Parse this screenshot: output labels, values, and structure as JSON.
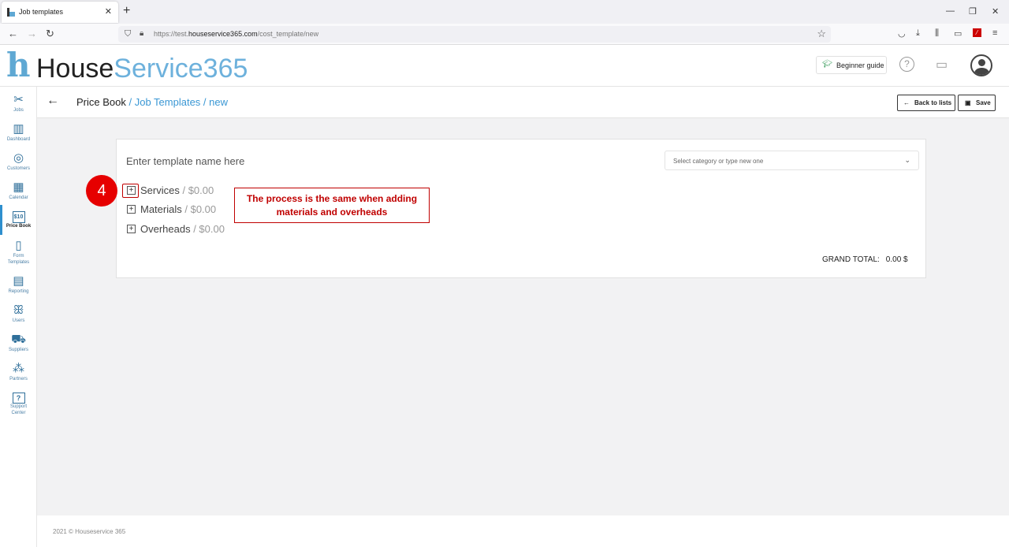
{
  "browser": {
    "tab_title": "Job templates",
    "tab_close": "✕",
    "new_tab": "+",
    "url_prefix": "https://test.",
    "url_domain": "houseservice365.com",
    "url_path": "/cost_template/new",
    "window_controls": [
      "—",
      "❐",
      "✕"
    ]
  },
  "app": {
    "logo_h": "h",
    "logo_word1": "House",
    "logo_word2": "Service365",
    "beginner_guide": "Beginner guide"
  },
  "sidebar": {
    "items": [
      {
        "label": "Jobs",
        "icon": "✂"
      },
      {
        "label": "Dashboard",
        "icon": "▥"
      },
      {
        "label": "Customers",
        "icon": "◎"
      },
      {
        "label": "Calendar",
        "icon": "▦"
      },
      {
        "label": "Price Book",
        "icon": "$10"
      },
      {
        "label": "Form",
        "label2": "Templates",
        "icon": "▯"
      },
      {
        "label": "Reporting",
        "icon": "▤"
      },
      {
        "label": "Users",
        "icon": "ꕥ"
      },
      {
        "label": "Suppliers",
        "icon": "⛟"
      },
      {
        "label": "Partners",
        "icon": "⁂"
      },
      {
        "label": "Support",
        "label2": "Center",
        "icon": "?"
      }
    ]
  },
  "breadcrumb": {
    "root": "Price Book",
    "path": " / Job Templates / new"
  },
  "toolbar": {
    "back_label": "Back to lists",
    "save_label": "Save"
  },
  "form": {
    "template_name_placeholder": "Enter template name here",
    "category_placeholder": "Select category or type new one",
    "sections": [
      {
        "name": "Services",
        "amount": " / $0.00"
      },
      {
        "name": "Materials",
        "amount": " / $0.00"
      },
      {
        "name": "Overheads",
        "amount": " / $0.00"
      }
    ],
    "grand_total_label": "GRAND TOTAL:",
    "grand_total_value": "0.00 $"
  },
  "footer": {
    "copyright": "2021 © Houseservice 365"
  },
  "annotation": {
    "step_number": "4",
    "callout_line1": "The process is the same when adding",
    "callout_line2": "materials and overheads"
  },
  "colors": {
    "accent": "#3a97d4",
    "annotation_red": "#c00000"
  }
}
